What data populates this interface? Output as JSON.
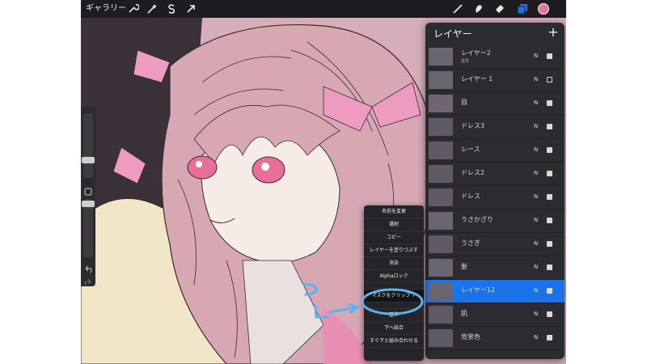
{
  "toolbar": {
    "gallery_label": "ギャラリー",
    "left_icons": [
      "wrench-icon",
      "magic-wand-icon",
      "selection-s-icon",
      "transform-arrow-icon"
    ],
    "right_icons": [
      "brush-icon",
      "smudge-icon",
      "eraser-icon",
      "layers-icon",
      "color-swatch-icon"
    ],
    "accent_color": "#1a73e8",
    "swatch_color": "#e9739a"
  },
  "layers_panel": {
    "title": "レイヤー",
    "add_label": "+",
    "layers": [
      {
        "name": "レイヤー2",
        "sub": "基準",
        "blend": "N",
        "visible": true
      },
      {
        "name": "レイヤー 1",
        "sub": "",
        "blend": "N",
        "visible": false
      },
      {
        "name": "目",
        "sub": "",
        "blend": "N",
        "visible": true
      },
      {
        "name": "ドレス3",
        "sub": "",
        "blend": "N",
        "visible": true
      },
      {
        "name": "レース",
        "sub": "",
        "blend": "N",
        "visible": true
      },
      {
        "name": "ドレス2",
        "sub": "",
        "blend": "N",
        "visible": true
      },
      {
        "name": "ドレス",
        "sub": "",
        "blend": "N",
        "visible": true
      },
      {
        "name": "うさかざり",
        "sub": "",
        "blend": "N",
        "visible": true
      },
      {
        "name": "うさぎ",
        "sub": "",
        "blend": "N",
        "visible": true
      },
      {
        "name": "髪",
        "sub": "",
        "blend": "N",
        "visible": true
      },
      {
        "name": "レイヤー12",
        "sub": "",
        "blend": "N",
        "visible": true,
        "selected": true
      },
      {
        "name": "肌",
        "sub": "",
        "blend": "N",
        "visible": true
      },
      {
        "name": "背景色",
        "sub": "",
        "blend": "N",
        "visible": true
      }
    ]
  },
  "context_menu": {
    "items": [
      {
        "label": "名前を変更"
      },
      {
        "label": "選択"
      },
      {
        "label": "コピー"
      },
      {
        "label": "レイヤーを塗りつぶす"
      },
      {
        "label": "消去"
      },
      {
        "label": "Alphaロック"
      },
      {
        "label": "",
        "spacer": true
      },
      {
        "label": "マスクをクリップ ✓",
        "highlighted": true
      },
      {
        "label": "",
        "spacer": true
      },
      {
        "label": "基準"
      },
      {
        "label": "下へ結合"
      },
      {
        "label": "すぐ下と組み合わせる"
      }
    ]
  },
  "annotation_color": "#5ab4f0"
}
